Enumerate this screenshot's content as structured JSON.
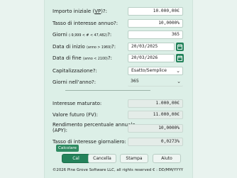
{
  "fields": {
    "initial_amount": {
      "label_pre": "Importo iniziale (",
      "label_abbr": "VP",
      "label_post": ")?:",
      "value": "10.000,00€"
    },
    "interest_rate": {
      "label": "Tasso di interesse annuo?:",
      "value": "10,0000%"
    },
    "days": {
      "label": "Giorni",
      "hint": "(-9,999 < # < 47,482)",
      "suffix": "?:",
      "value": "365"
    },
    "start_date": {
      "label": "Data di inizio",
      "hint": "(anno > 1969)",
      "suffix": "?:",
      "value": "20/03/2025"
    },
    "end_date": {
      "label": "Data di fine",
      "hint": "(anno < 2100)",
      "suffix": "?:",
      "value": "20/03/2026"
    },
    "capitalization": {
      "label": "Capitalizzazione?:",
      "value": "Esatto/Semplice"
    },
    "days_in_year": {
      "label": "Giorni nell'anno?:",
      "value": "365"
    }
  },
  "results": {
    "interest_accrued": {
      "label": "Interesse maturato:",
      "value": "1.000,00€"
    },
    "future_value": {
      "label": "Valore futuro (FV):",
      "value": "11.000,00€"
    },
    "apy": {
      "label_line1": "Rendimento percentuale annuale",
      "label_line2": "(APY):",
      "value": "10,0000%"
    },
    "daily_rate": {
      "label": "Tasso di interesse giornaliero:",
      "value": "0,0273%"
    }
  },
  "tooltip": "Calcolare",
  "buttons": {
    "calc": "Cal",
    "cancel": "Cancella",
    "print": "Stampa",
    "help": "Aiuto"
  },
  "footer": "©2026 Pine Grove Software LLC, all rights reserved  € : DD/MM/YYYY",
  "colors": {
    "accent": "#23825a",
    "background": "#e9f3ef",
    "panel": "#dcefe7"
  }
}
